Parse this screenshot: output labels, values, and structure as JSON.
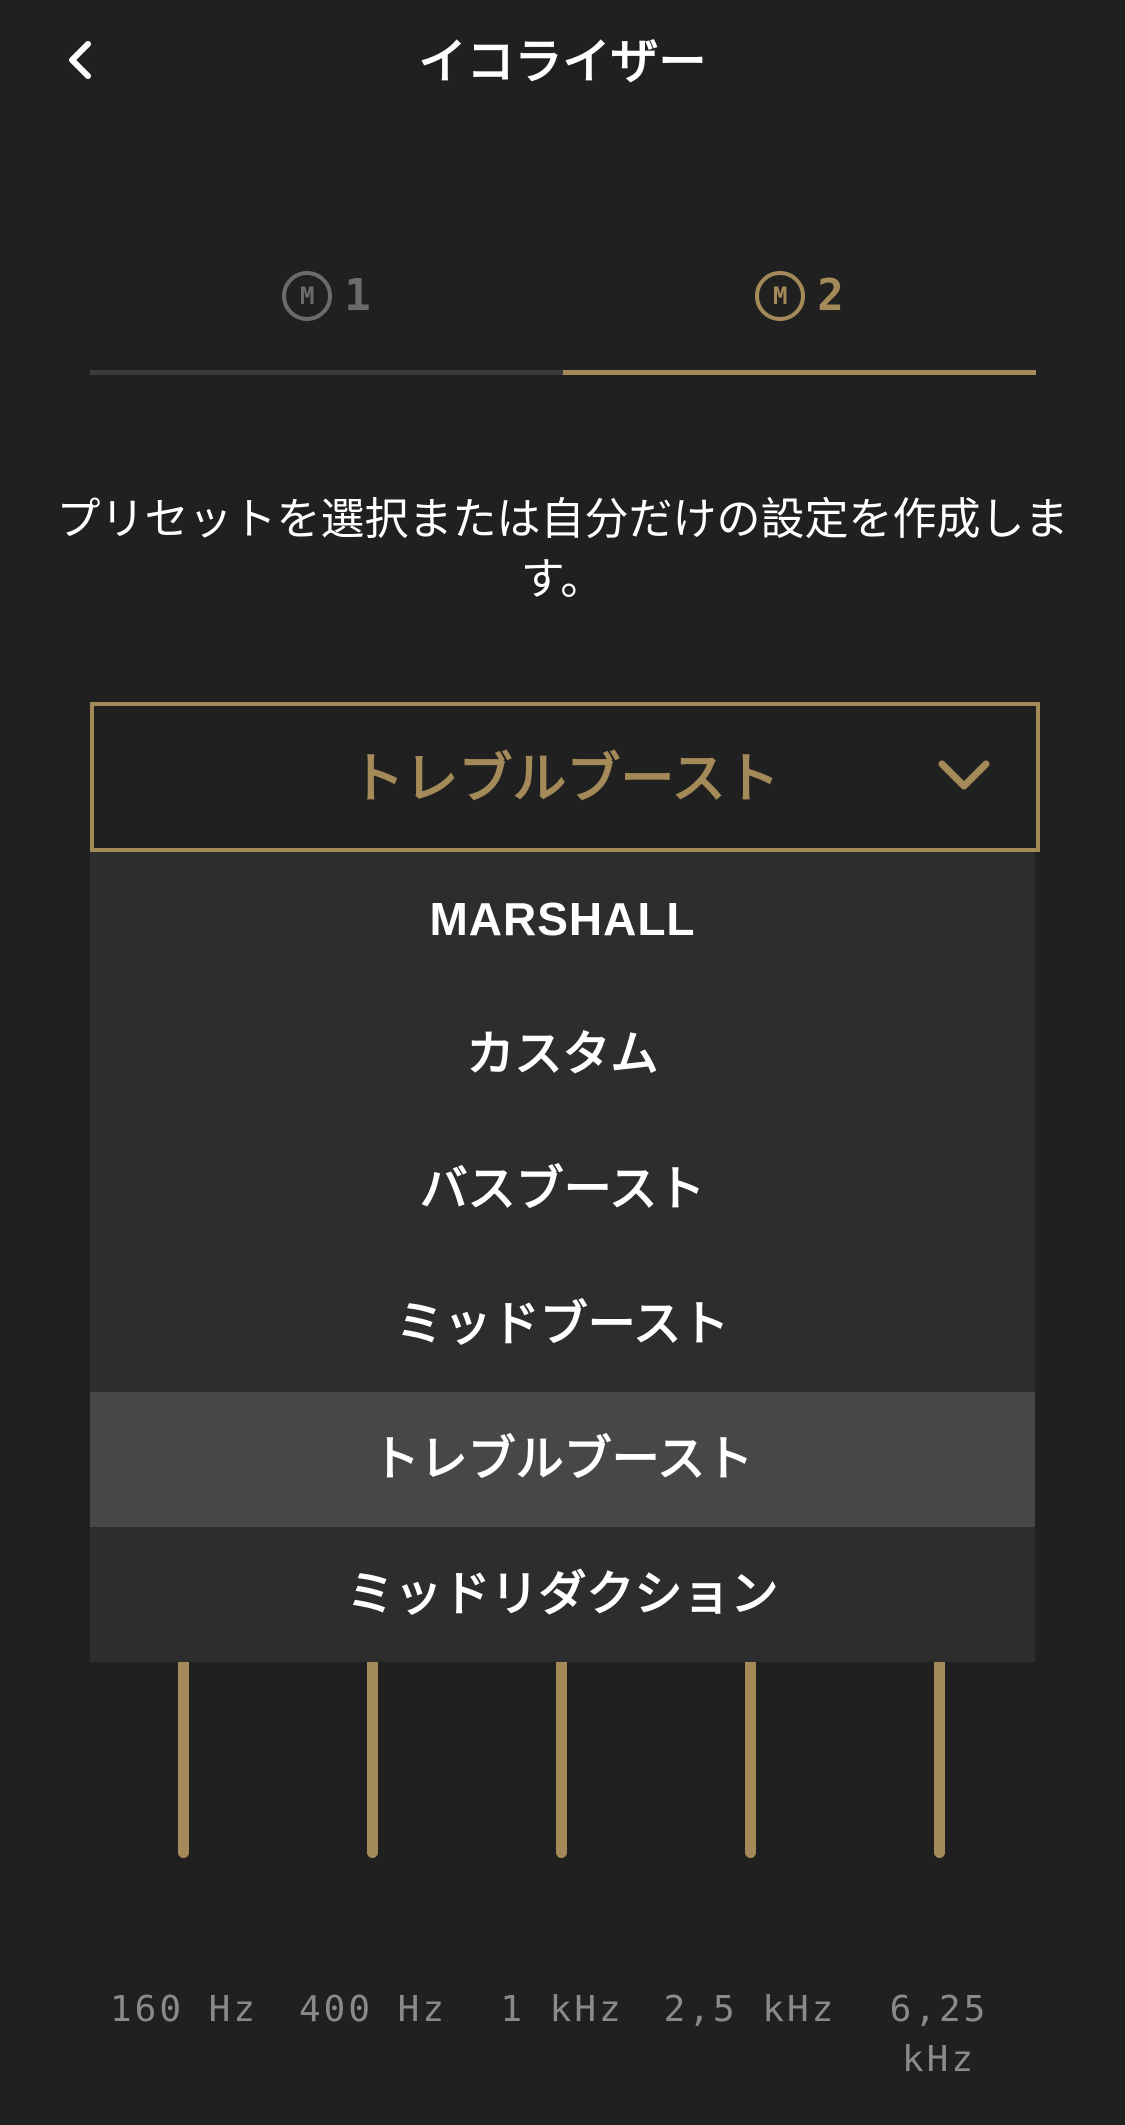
{
  "header": {
    "title": "イコライザー",
    "back_icon": "chevron-left-icon"
  },
  "tabs": [
    {
      "badge": "M",
      "number": "1",
      "active": false
    },
    {
      "badge": "M",
      "number": "2",
      "active": true
    }
  ],
  "subtitle": "プリセットを選択または自分だけの設定を作成します。",
  "preset_select": {
    "value": "トレブルブースト",
    "icon": "chevron-down-icon"
  },
  "dropdown": {
    "options": [
      {
        "label": "MARSHALL",
        "selected": false
      },
      {
        "label": "カスタム",
        "selected": false
      },
      {
        "label": "バスブースト",
        "selected": false
      },
      {
        "label": "ミッドブースト",
        "selected": false
      },
      {
        "label": "トレブルブースト",
        "selected": true
      },
      {
        "label": "ミッドリダクション",
        "selected": false
      }
    ]
  },
  "equalizer": {
    "bands": [
      {
        "label": "160 Hz"
      },
      {
        "label": "400 Hz"
      },
      {
        "label": "1 kHz"
      },
      {
        "label": "2,5 kHz"
      },
      {
        "label": "6,25 kHz"
      }
    ]
  },
  "colors": {
    "background": "#202020",
    "accent": "#a58a59",
    "dropdown_bg": "#2d2d2d",
    "selected_bg": "#474747",
    "inactive_tab": "#6b6b6b",
    "freq_label": "#8a8a8a"
  }
}
